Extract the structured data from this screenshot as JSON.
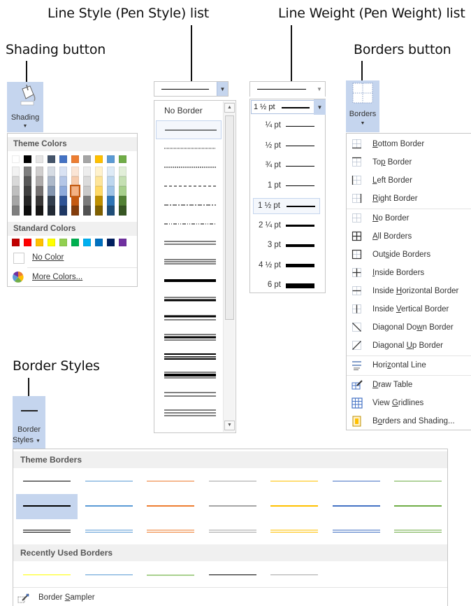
{
  "callouts": {
    "line_style": "Line Style (Pen Style) list",
    "line_weight": "Line Weight (Pen Weight) list",
    "shading": "Shading button",
    "borders": "Borders button",
    "border_styles": "Border Styles"
  },
  "shading": {
    "button_label": "Shading",
    "theme_colors_heading": "Theme Colors",
    "standard_colors_heading": "Standard Colors",
    "no_color": "No Color",
    "more_colors": "More Colors...",
    "theme_top_row": [
      "#ffffff",
      "#000000",
      "#e7e6e6",
      "#44546a",
      "#4472c4",
      "#ed7d31",
      "#a5a5a5",
      "#ffc000",
      "#5b9bd5",
      "#70ad47"
    ],
    "theme_shade_columns": [
      [
        "#f2f2f2",
        "#d9d9d9",
        "#bfbfbf",
        "#a6a6a6",
        "#7f7f7f"
      ],
      [
        "#7f7f7f",
        "#595959",
        "#404040",
        "#262626",
        "#0d0d0d"
      ],
      [
        "#d0cece",
        "#aeabab",
        "#757171",
        "#3a3838",
        "#171616"
      ],
      [
        "#d6dce4",
        "#adb9ca",
        "#8496b0",
        "#333f4f",
        "#222a35"
      ],
      [
        "#d9e2f3",
        "#b4c6e7",
        "#8eaadb",
        "#2f5496",
        "#1f3864"
      ],
      [
        "#fbe5d5",
        "#f7cbac",
        "#f4b183",
        "#c55a11",
        "#833c0b"
      ],
      [
        "#ededed",
        "#dbdbdb",
        "#c9c9c9",
        "#7b7b7b",
        "#525252"
      ],
      [
        "#fff2cc",
        "#fee599",
        "#ffd965",
        "#bf9000",
        "#7f6000"
      ],
      [
        "#deebf6",
        "#bdd7ee",
        "#9dc3e6",
        "#2e75b5",
        "#1f4e79"
      ],
      [
        "#e2efd9",
        "#c5e0b3",
        "#a8d08d",
        "#538135",
        "#375623"
      ]
    ],
    "standard_row": [
      "#c00000",
      "#ff0000",
      "#ffc000",
      "#ffff00",
      "#92d050",
      "#00b050",
      "#00b0f0",
      "#0070c0",
      "#002060",
      "#7030a0"
    ]
  },
  "pen_style": {
    "no_border": "No Border"
  },
  "pen_weight": {
    "current": "1 ½ pt",
    "items": [
      {
        "label": "¼ pt",
        "w": 1
      },
      {
        "label": "½ pt",
        "w": 1
      },
      {
        "label": "¾ pt",
        "w": 1
      },
      {
        "label": "1 pt",
        "w": 1.5
      },
      {
        "label": "1 ½ pt",
        "w": 2
      },
      {
        "label": "2 ¼ pt",
        "w": 3
      },
      {
        "label": "3 pt",
        "w": 4
      },
      {
        "label": "4 ½ pt",
        "w": 5
      },
      {
        "label": "6 pt",
        "w": 7
      }
    ]
  },
  "borders": {
    "button_label": "Borders",
    "items": [
      {
        "pre": "",
        "u": "B",
        "post": "ottom Border",
        "icon": "bottom-border-icon"
      },
      {
        "pre": "To",
        "u": "p",
        "post": " Border",
        "icon": "top-border-icon"
      },
      {
        "pre": "",
        "u": "L",
        "post": "eft Border",
        "icon": "left-border-icon"
      },
      {
        "pre": "",
        "u": "R",
        "post": "ight Border",
        "icon": "right-border-icon"
      },
      {
        "pre": "",
        "u": "N",
        "post": "o Border",
        "icon": "no-border-icon"
      },
      {
        "pre": "",
        "u": "A",
        "post": "ll Borders",
        "icon": "all-borders-icon"
      },
      {
        "pre": "Out",
        "u": "s",
        "post": "ide Borders",
        "icon": "outside-borders-icon"
      },
      {
        "pre": "",
        "u": "I",
        "post": "nside Borders",
        "icon": "inside-borders-icon"
      },
      {
        "pre": "Inside ",
        "u": "H",
        "post": "orizontal Border",
        "icon": "inside-horizontal-border-icon"
      },
      {
        "pre": "Inside ",
        "u": "V",
        "post": "ertical Border",
        "icon": "inside-vertical-border-icon"
      },
      {
        "pre": "Diagonal Do",
        "u": "w",
        "post": "n Border",
        "icon": "diagonal-down-border-icon"
      },
      {
        "pre": "Diagonal ",
        "u": "U",
        "post": "p Border",
        "icon": "diagonal-up-border-icon"
      },
      {
        "pre": "Hori",
        "u": "z",
        "post": "ontal Line",
        "icon": "horizontal-line-icon"
      },
      {
        "pre": "",
        "u": "D",
        "post": "raw Table",
        "icon": "draw-table-icon"
      },
      {
        "pre": "View ",
        "u": "G",
        "post": "ridlines",
        "icon": "view-gridlines-icon"
      },
      {
        "pre": "B",
        "u": "o",
        "post": "rders and Shading...",
        "icon": "borders-and-shading-icon"
      }
    ]
  },
  "border_styles": {
    "button_label_1": "Border",
    "button_label_2": "Styles",
    "theme_borders_heading": "Theme Borders",
    "recently_used_heading": "Recently Used Borders",
    "sampler_pre": "Border ",
    "sampler_u": "S",
    "sampler_post": "ampler",
    "theme_colors": [
      "#000000",
      "#5b9bd5",
      "#ed7d31",
      "#a5a5a5",
      "#ffc000",
      "#4472c4",
      "#70ad47"
    ],
    "recent_colors": [
      "#ffff00",
      "#5b9bd5",
      "#a9d18e",
      "#000000",
      "#a5a5a5"
    ]
  }
}
